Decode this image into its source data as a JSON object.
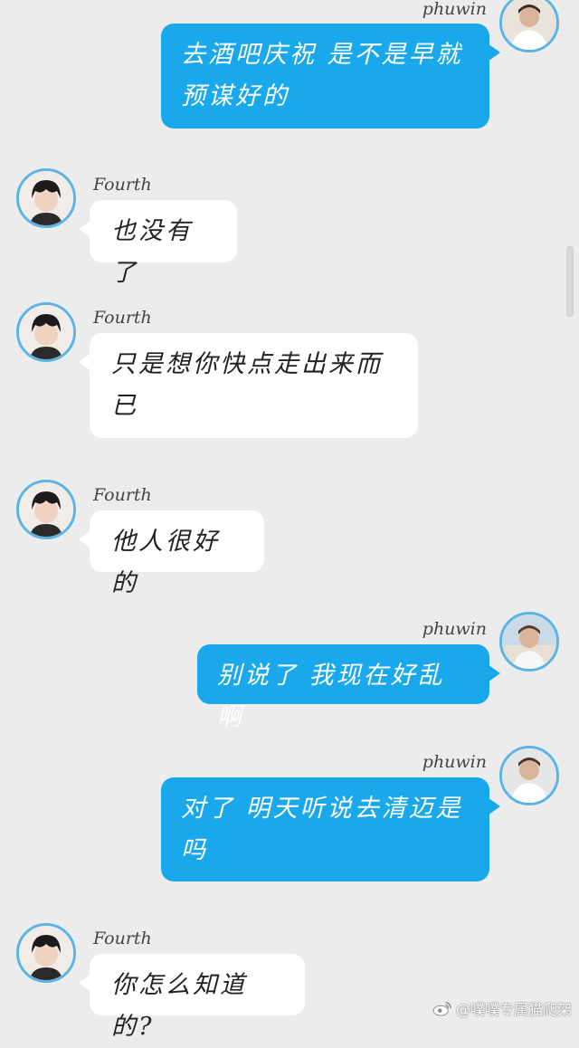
{
  "messages": [
    {
      "side": "out",
      "name": "phuwin",
      "text": "去酒吧庆祝 是不是早就预谋好的"
    },
    {
      "side": "in",
      "name": "Fourth",
      "text": "也没有了"
    },
    {
      "side": "in",
      "name": "Fourth",
      "text": "只是想你快点走出来而已"
    },
    {
      "side": "in",
      "name": "Fourth",
      "text": "他人很好的"
    },
    {
      "side": "out",
      "name": "phuwin",
      "text": "别说了 我现在好乱啊"
    },
    {
      "side": "out",
      "name": "phuwin",
      "text": "对了 明天听说去清迈是吗"
    },
    {
      "side": "in",
      "name": "Fourth",
      "text": "你怎么知道的?"
    }
  ],
  "watermark": {
    "text": "@噗噗专属猫爬架",
    "icon": "weibo-icon"
  },
  "colors": {
    "outgoing_bubble": "#1aa8ec",
    "incoming_bubble": "#ffffff",
    "avatar_border": "#5bb4e6",
    "background": "#ececec"
  }
}
